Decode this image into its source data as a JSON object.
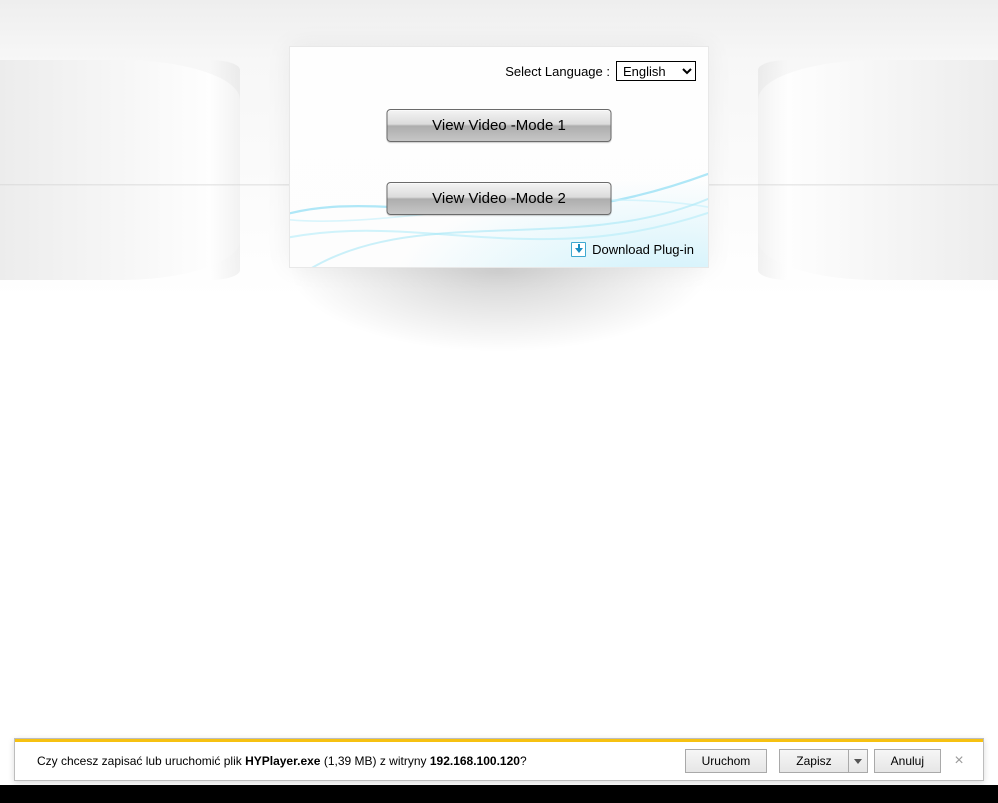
{
  "lang": {
    "label": "Select Language :",
    "selected": "English"
  },
  "buttons": {
    "mode1": "View Video -Mode 1",
    "mode2": "View Video -Mode 2"
  },
  "download_link": "Download Plug-in",
  "notif": {
    "prefix": "Czy chcesz zapisać lub uruchomić plik ",
    "filename": "HYPlayer.exe",
    "size": " (1,39 MB) z witryny ",
    "host": "192.168.100.120",
    "suffix": "?",
    "run": "Uruchom",
    "save": "Zapisz",
    "cancel": "Anuluj"
  }
}
